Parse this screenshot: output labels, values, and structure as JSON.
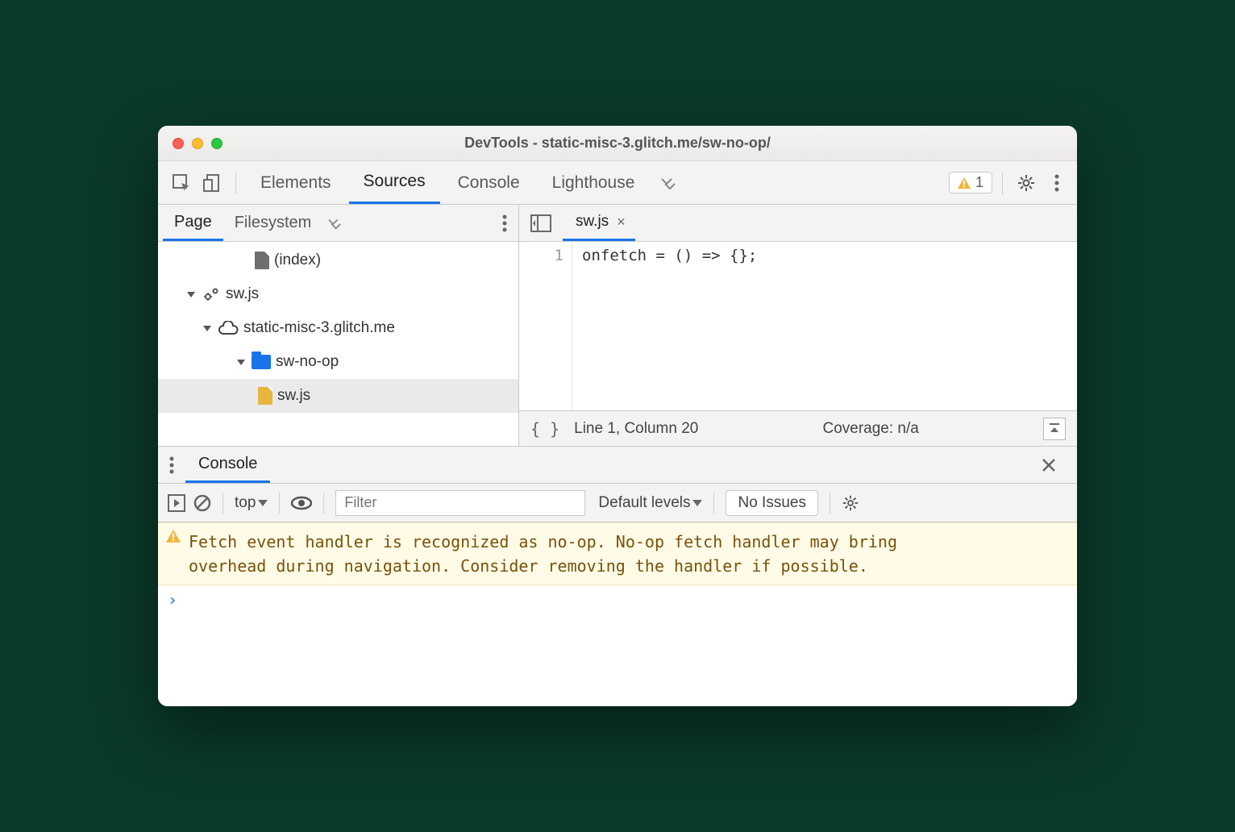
{
  "window": {
    "title": "DevTools - static-misc-3.glitch.me/sw-no-op/"
  },
  "mainTabs": [
    "Elements",
    "Sources",
    "Console",
    "Lighthouse"
  ],
  "mainTabActive": "Sources",
  "warningBadge": "1",
  "sidebar": {
    "tabs": [
      "Page",
      "Filesystem"
    ],
    "active": "Page",
    "tree": {
      "indexLabel": "(index)",
      "swRootLabel": "sw.js",
      "domainLabel": "static-misc-3.glitch.me",
      "folderLabel": "sw-no-op",
      "fileLabel": "sw.js"
    }
  },
  "editor": {
    "openFile": "sw.js",
    "lineNum": "1",
    "code": "onfetch = () => {};",
    "statusPosition": "Line 1, Column 20",
    "coverage": "Coverage: n/a"
  },
  "drawer": {
    "tab": "Console",
    "context": "top",
    "filterPlaceholder": "Filter",
    "levels": "Default levels",
    "issues": "No Issues",
    "warning": "Fetch event handler is recognized as no-op. No-op fetch handler may bring overhead during navigation. Consider removing the handler if possible.",
    "prompt": "›"
  }
}
